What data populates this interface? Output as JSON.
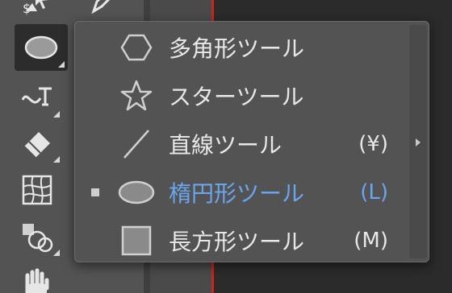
{
  "colors": {
    "panel": "#535353",
    "selected_text": "#6aa6ee",
    "text": "#e8e8e8",
    "accent_red": "#c5281c"
  },
  "toolbar": {
    "tools": [
      {
        "name": "direct-select-tool",
        "icon": "direct-select-icon"
      },
      {
        "name": "pen-tool",
        "icon": "pen-icon"
      },
      {
        "name": "ellipse-tool",
        "icon": "ellipse-icon",
        "active": true
      },
      {
        "name": "curvature-tool",
        "icon": "curvature-icon"
      },
      {
        "name": "eraser-tool",
        "icon": "eraser-icon"
      },
      {
        "name": "mesh-tool",
        "icon": "mesh-icon"
      },
      {
        "name": "shape-builder-tool",
        "icon": "shape-builder-icon"
      },
      {
        "name": "hand-tool",
        "icon": "hand-icon"
      }
    ]
  },
  "flyout": {
    "items": [
      {
        "label": "多角形ツール",
        "shortcut": "",
        "icon": "polygon-icon",
        "selected": false
      },
      {
        "label": "スターツール",
        "shortcut": "",
        "icon": "star-icon",
        "selected": false
      },
      {
        "label": "直線ツール",
        "shortcut": "(¥)",
        "icon": "line-icon",
        "selected": false
      },
      {
        "label": "楕円形ツール",
        "shortcut": "(L)",
        "icon": "ellipse-icon",
        "selected": true
      },
      {
        "label": "長方形ツール",
        "shortcut": "(M)",
        "icon": "rectangle-icon",
        "selected": false
      }
    ]
  }
}
